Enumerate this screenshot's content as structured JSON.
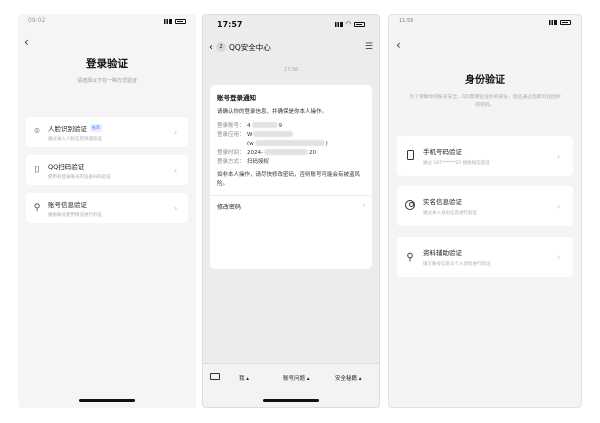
{
  "phone1": {
    "status_time": "09:02",
    "title": "登录验证",
    "subtitle": "请选择以下任一种方式验证",
    "items": [
      {
        "label": "人脸识别验证",
        "badge": "推荐",
        "desc": "通过录入人脸信息快速验证",
        "icon": "face-scan-icon"
      },
      {
        "label": "QQ扫码验证",
        "badge": "",
        "desc": "使用有登录账号的设备扫码验证",
        "icon": "qr-scan-icon"
      },
      {
        "label": "账号信息验证",
        "badge": "",
        "desc": "根据账号使用情况进行验证",
        "icon": "user-key-icon"
      }
    ]
  },
  "phone2": {
    "status_time": "17:57",
    "back_count": "2",
    "header_title": "QQ安全中心",
    "msg_time": "17:56",
    "msg_title": "账号登录通知",
    "msg_intro": "请确认你的登录信息，并确保是你本人操作。",
    "fields": [
      {
        "key": "登录账号：",
        "val_pre": "4",
        "val_post": "9"
      },
      {
        "key": "登录应用：",
        "val_pre": "W",
        "val_post": ""
      },
      {
        "key": "",
        "val_pre": "(w",
        "val_post": ")"
      },
      {
        "key": "登录时间：",
        "val_pre": "2024-",
        "val_post": "20"
      },
      {
        "key": "登录方式：",
        "val_pre": "扫码授权",
        "val_post": ""
      }
    ],
    "warning": "如非本人操作，请尽快修改密码，否则账号可能会有被盗风险。",
    "change_pwd": "修改密码",
    "bottom": [
      "我 ▴",
      "账号问题 ▴",
      "安全秘籍 ▴"
    ]
  },
  "phone3": {
    "status_time": "11:55",
    "title": "身份验证",
    "subtitle": "为了保障你的账号安全，QQ需要验证你的身份，验证通过后即可找回你的密码。",
    "items": [
      {
        "label": "手机号码验证",
        "desc": "通过 187******25 接收短信验证",
        "icon": "phone-icon"
      },
      {
        "label": "实名信息验证",
        "desc": "通过本人身份信息进行验证",
        "icon": "id-card-icon"
      },
      {
        "label": "资料辅助验证",
        "desc": "填写账号信息与个人资料进行验证",
        "icon": "user-key-icon"
      }
    ]
  }
}
